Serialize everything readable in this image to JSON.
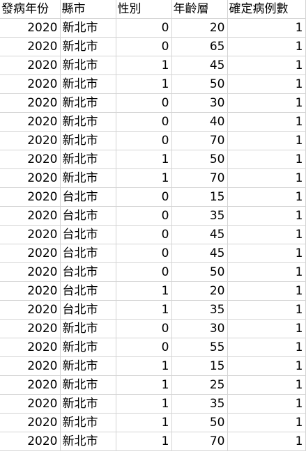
{
  "columns": [
    "發病年份",
    "縣市",
    "性別",
    "年齡層",
    "確定病例數"
  ],
  "rows": [
    [
      "2020",
      "新北市",
      "0",
      "20",
      "1"
    ],
    [
      "2020",
      "新北市",
      "0",
      "65",
      "1"
    ],
    [
      "2020",
      "新北市",
      "1",
      "45",
      "1"
    ],
    [
      "2020",
      "新北市",
      "1",
      "50",
      "1"
    ],
    [
      "2020",
      "新北市",
      "0",
      "30",
      "1"
    ],
    [
      "2020",
      "新北市",
      "0",
      "40",
      "1"
    ],
    [
      "2020",
      "新北市",
      "0",
      "70",
      "1"
    ],
    [
      "2020",
      "新北市",
      "1",
      "50",
      "1"
    ],
    [
      "2020",
      "新北市",
      "1",
      "70",
      "1"
    ],
    [
      "2020",
      "台北市",
      "0",
      "15",
      "1"
    ],
    [
      "2020",
      "台北市",
      "0",
      "35",
      "1"
    ],
    [
      "2020",
      "台北市",
      "0",
      "45",
      "1"
    ],
    [
      "2020",
      "台北市",
      "0",
      "45",
      "1"
    ],
    [
      "2020",
      "台北市",
      "0",
      "50",
      "1"
    ],
    [
      "2020",
      "台北市",
      "1",
      "20",
      "1"
    ],
    [
      "2020",
      "台北市",
      "1",
      "35",
      "1"
    ],
    [
      "2020",
      "新北市",
      "0",
      "30",
      "1"
    ],
    [
      "2020",
      "新北市",
      "0",
      "55",
      "1"
    ],
    [
      "2020",
      "新北市",
      "1",
      "15",
      "1"
    ],
    [
      "2020",
      "新北市",
      "1",
      "25",
      "1"
    ],
    [
      "2020",
      "新北市",
      "1",
      "35",
      "1"
    ],
    [
      "2020",
      "新北市",
      "1",
      "50",
      "1"
    ],
    [
      "2020",
      "新北市",
      "1",
      "70",
      "1"
    ]
  ],
  "column_types": [
    "num",
    "txt",
    "num",
    "num",
    "num"
  ]
}
